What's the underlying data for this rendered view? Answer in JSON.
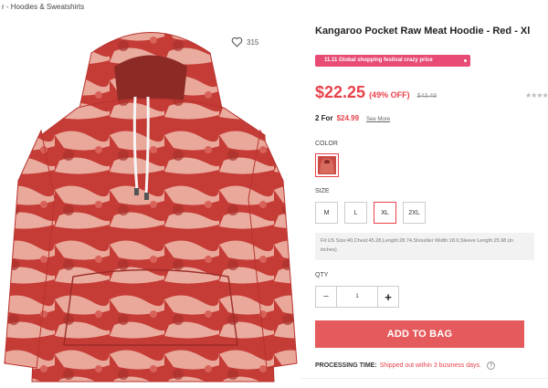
{
  "breadcrumb": "r  -  Hoodies & Sweatshirts",
  "favorites": {
    "count": "315",
    "icon": "heart-icon"
  },
  "product": {
    "title": "Kangaroo Pocket Raw Meat Hoodie - Red - Xl",
    "promo_banner": "11.11 Global shopping festival crazy price",
    "price": "$22.25",
    "discount": "(49% OFF)",
    "original_price": "$43.49",
    "rating_glyphs": "★★★★★",
    "deal_label": "2 For",
    "deal_price": "$24.99",
    "see_more": "See More"
  },
  "color": {
    "label": "COLOR",
    "selected": "Red"
  },
  "size": {
    "label": "SIZE",
    "options": [
      "M",
      "L",
      "XL",
      "2XL"
    ],
    "selected": "XL"
  },
  "fit_note": "Fit US Size:40,Chest:45.28,Length:28.74,Shoulder Width:18.9,Sleeve Length:25.98.(in inches)",
  "quantity": {
    "label": "QTY",
    "value": "1",
    "minus": "−",
    "plus": "+"
  },
  "add_to_bag_label": "ADD TO BAG",
  "processing": {
    "label": "PROCESSING TIME:",
    "text": "Shipped out within 3 business days.",
    "help": "?"
  },
  "colors": {
    "accent": "#e8424c",
    "button": "#e55b5d",
    "promo": "#e84c75"
  }
}
